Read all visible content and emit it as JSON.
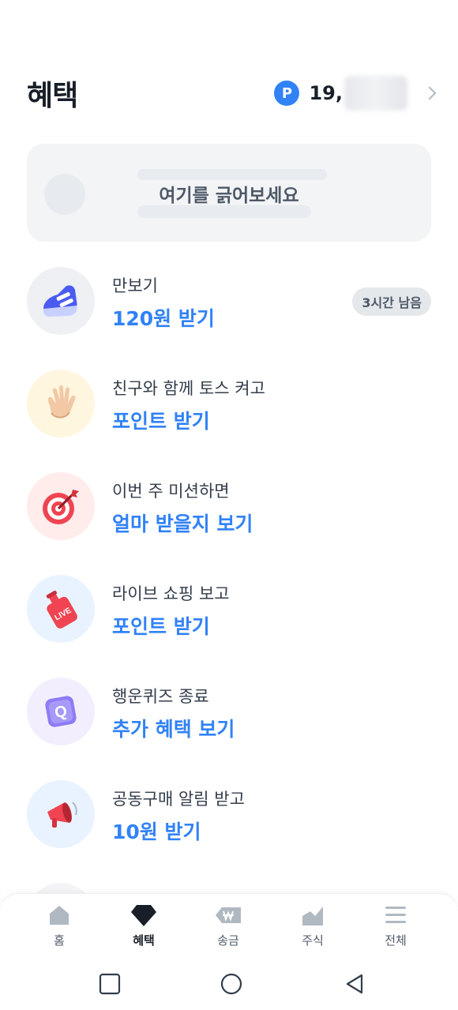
{
  "header": {
    "title": "혜택",
    "points_badge": "P",
    "points_value": "19,"
  },
  "scratch_card": {
    "label": "여기를 긁어보세요"
  },
  "benefits": [
    {
      "subtitle": "만보기",
      "action": "120원 받기",
      "chip": "3시간 남음",
      "icon": "sneaker-icon"
    },
    {
      "subtitle": "친구와 함께 토스 켜고",
      "action": "포인트 받기",
      "icon": "waving-hand-icon"
    },
    {
      "subtitle": "이번 주 미션하면",
      "action": "얼마 받을지 보기",
      "icon": "target-icon"
    },
    {
      "subtitle": "라이브 쇼핑 보고",
      "action": "포인트 받기",
      "icon": "live-bottle-icon",
      "live_text": "LIVE"
    },
    {
      "subtitle": "행운퀴즈 종료",
      "action": "추가 혜택 보기",
      "icon": "quiz-cube-icon",
      "quiz_letter": "Q"
    },
    {
      "subtitle": "공동구매 알림 받고",
      "action": "10원 받기",
      "icon": "megaphone-icon"
    }
  ],
  "tabbar": {
    "tabs": [
      {
        "label": "홈",
        "icon": "home-icon"
      },
      {
        "label": "혜택",
        "icon": "diamond-icon",
        "active": true
      },
      {
        "label": "송금",
        "icon": "won-send-icon"
      },
      {
        "label": "주식",
        "icon": "stock-chart-icon"
      },
      {
        "label": "전체",
        "icon": "menu-icon"
      }
    ]
  },
  "colors": {
    "accent": "#3182f6",
    "text": "#191f28",
    "muted": "#4e5968",
    "chip_bg": "#e5e8eb",
    "card_bg": "#f2f4f6"
  }
}
